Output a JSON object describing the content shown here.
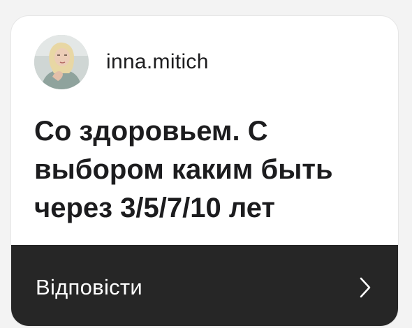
{
  "sticker": {
    "avatar_icon": "profile-photo",
    "username": "inna.mitich",
    "question": "Со здоровьем. С выбором каким быть через 3/5/7/10 лет",
    "reply_label": "Відповісти",
    "reply_icon": "chevron-right-icon"
  },
  "colors": {
    "card_background": "#ffffff",
    "reply_bar_background": "#262626",
    "text_primary": "#1c1c1e",
    "reply_text": "#ffffff"
  }
}
